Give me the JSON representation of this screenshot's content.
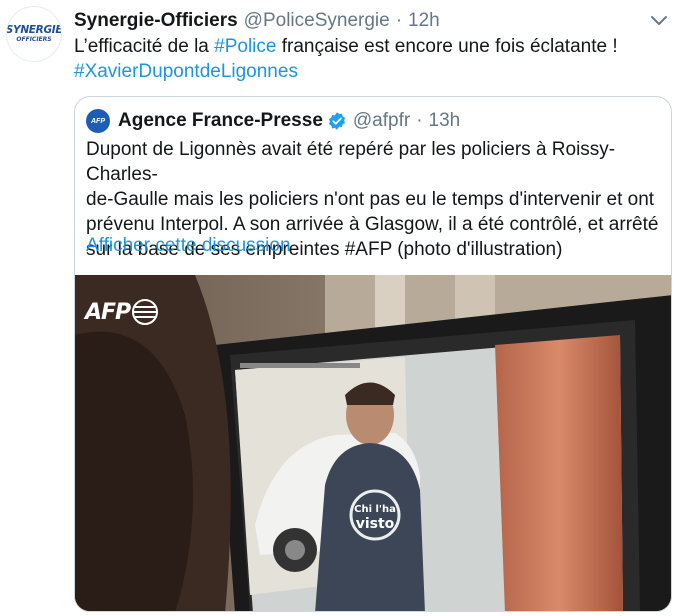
{
  "tweet": {
    "avatar_line1": "SYNERGIE",
    "avatar_line2": "OFFICIERS",
    "name": "Synergie-Officiers",
    "handle": "@PoliceSynergie",
    "separator": "·",
    "time": "12h",
    "text_part1": "L’efficacité de la ",
    "hashtag1": "#Police",
    "text_part2": " française est encore une fois éclatante !",
    "hashtag2": "#XavierDupontdeLigonnes"
  },
  "quote": {
    "avatar_text": "AFP",
    "name": "Agence France-Presse",
    "handle": "@afpfr",
    "separator": "·",
    "time": "13h",
    "text_line1": "Dupont de Ligonnès avait été repéré par les policiers à Roissy-Charles-",
    "text_line2": "de-Gaulle mais les policiers n'ont pas eu le temps d'intervenir et ont",
    "text_line3": "prévenu Interpol. A son arrivée à Glasgow, il a été contrôlé, et arrêté",
    "text_line4": "sur la base de ses empreintes #AFP (photo d'illustration)",
    "show_thread": "Afficher cette discussion",
    "media_logo": "AFP",
    "watermark_line1": "Chi l'ha",
    "watermark_line2": "visto"
  },
  "colors": {
    "link": "#1b95e0",
    "secondary": "#657786",
    "verified": "#1da1f2",
    "border": "#ccd6dd"
  },
  "icons": {
    "chevron": "chevron-down-icon",
    "verified": "verified-badge-icon"
  }
}
